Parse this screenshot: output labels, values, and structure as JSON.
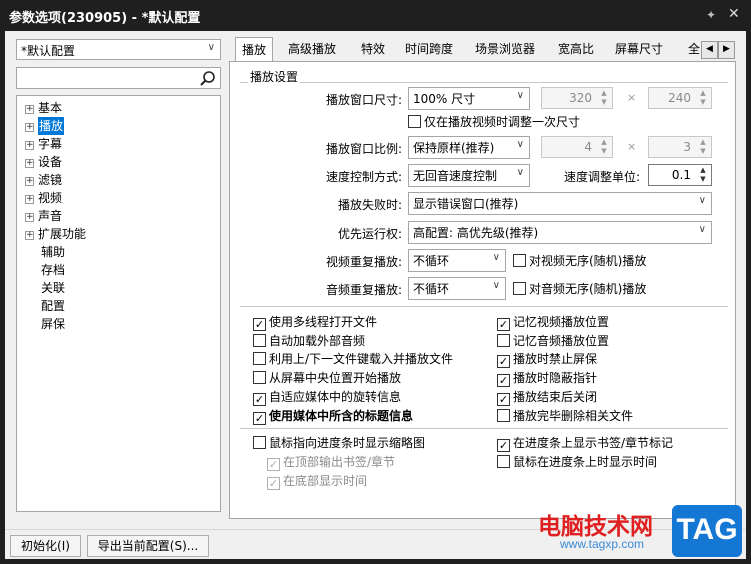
{
  "window": {
    "title": "参数选项(230905) - *默认配置",
    "pin_icon": "pin-icon",
    "close_icon": "close-icon"
  },
  "profile_combo": {
    "value": "*默认配置"
  },
  "search": {
    "placeholder": "",
    "icon": "search-icon"
  },
  "tree": [
    {
      "label": "基本",
      "expandable": true,
      "selected": false
    },
    {
      "label": "播放",
      "expandable": true,
      "selected": true
    },
    {
      "label": "字幕",
      "expandable": true,
      "selected": false
    },
    {
      "label": "设备",
      "expandable": true,
      "selected": false
    },
    {
      "label": "滤镜",
      "expandable": true,
      "selected": false
    },
    {
      "label": "视频",
      "expandable": true,
      "selected": false
    },
    {
      "label": "声音",
      "expandable": true,
      "selected": false
    },
    {
      "label": "扩展功能",
      "expandable": true,
      "selected": false
    },
    {
      "label": "辅助",
      "expandable": false,
      "selected": false
    },
    {
      "label": "存档",
      "expandable": false,
      "selected": false
    },
    {
      "label": "关联",
      "expandable": false,
      "selected": false
    },
    {
      "label": "配置",
      "expandable": false,
      "selected": false
    },
    {
      "label": "屏保",
      "expandable": false,
      "selected": false
    }
  ],
  "tabs": [
    "播放",
    "高级播放",
    "特效",
    "时间跨度",
    "场景浏览器",
    "宽高比",
    "屏幕尺寸",
    "全"
  ],
  "active_tab": "播放",
  "group_title": "播放设置",
  "settings": {
    "window_size_label": "播放窗口尺寸:",
    "window_size_value": "100% 尺寸",
    "width_value": "320",
    "height_value": "240",
    "times": "×",
    "adjust_once_label": "仅在播放视频时调整一次尺寸",
    "adjust_once_checked": false,
    "ratio_label": "播放窗口比例:",
    "ratio_value": "保持原样(推荐)",
    "ratio_w": "4",
    "ratio_h": "3",
    "speed_mode_label": "速度控制方式:",
    "speed_mode_value": "无回音速度控制",
    "speed_unit_label": "速度调整单位:",
    "speed_unit_value": "0.1",
    "fail_label": "播放失败时:",
    "fail_value": "显示错误窗口(推荐)",
    "priority_label": "优先运行权:",
    "priority_value": "高配置: 高优先级(推荐)",
    "video_repeat_label": "视频重复播放:",
    "video_repeat_value": "不循环",
    "video_shuffle_label": "对视频无序(随机)播放",
    "video_shuffle_checked": false,
    "audio_repeat_label": "音频重复播放:",
    "audio_repeat_value": "不循环",
    "audio_shuffle_label": "对音频无序(随机)播放",
    "audio_shuffle_checked": false
  },
  "options_left": [
    {
      "label": "使用多线程打开文件",
      "checked": true,
      "bold": false
    },
    {
      "label": "自动加载外部音频",
      "checked": false,
      "bold": false
    },
    {
      "label": "利用上/下一文件键载入并播放文件",
      "checked": false,
      "bold": false
    },
    {
      "label": "从屏幕中央位置开始播放",
      "checked": false,
      "bold": false
    },
    {
      "label": "自适应媒体中的旋转信息",
      "checked": true,
      "bold": false
    },
    {
      "label": "使用媒体中所含的标题信息",
      "checked": true,
      "bold": true
    }
  ],
  "options_right": [
    {
      "label": "记忆视频播放位置",
      "checked": true
    },
    {
      "label": "记忆音频播放位置",
      "checked": false
    },
    {
      "label": "播放时禁止屏保",
      "checked": true
    },
    {
      "label": "播放时隐蔽指针",
      "checked": true
    },
    {
      "label": "播放结束后关闭",
      "checked": true
    },
    {
      "label": "播放完毕删除相关文件",
      "checked": false
    }
  ],
  "seek": {
    "thumb_label": "鼠标指向进度条时显示缩略图",
    "thumb_checked": false,
    "top_bookmark_label": "在顶部输出书签/章节",
    "top_bookmark_checked": true,
    "bottom_time_label": "在底部显示时间",
    "bottom_time_checked": true,
    "show_marks_label": "在进度条上显示书签/章节标记",
    "show_marks_checked": true,
    "show_time_label": "鼠标在进度条上时显示时间",
    "show_time_checked": false
  },
  "buttons": {
    "init": "初始化(I)",
    "export": "导出当前配置(S)..."
  },
  "watermark": {
    "site": "电脑技术网",
    "url": "www.tagxp.com",
    "tag": "TAG"
  }
}
